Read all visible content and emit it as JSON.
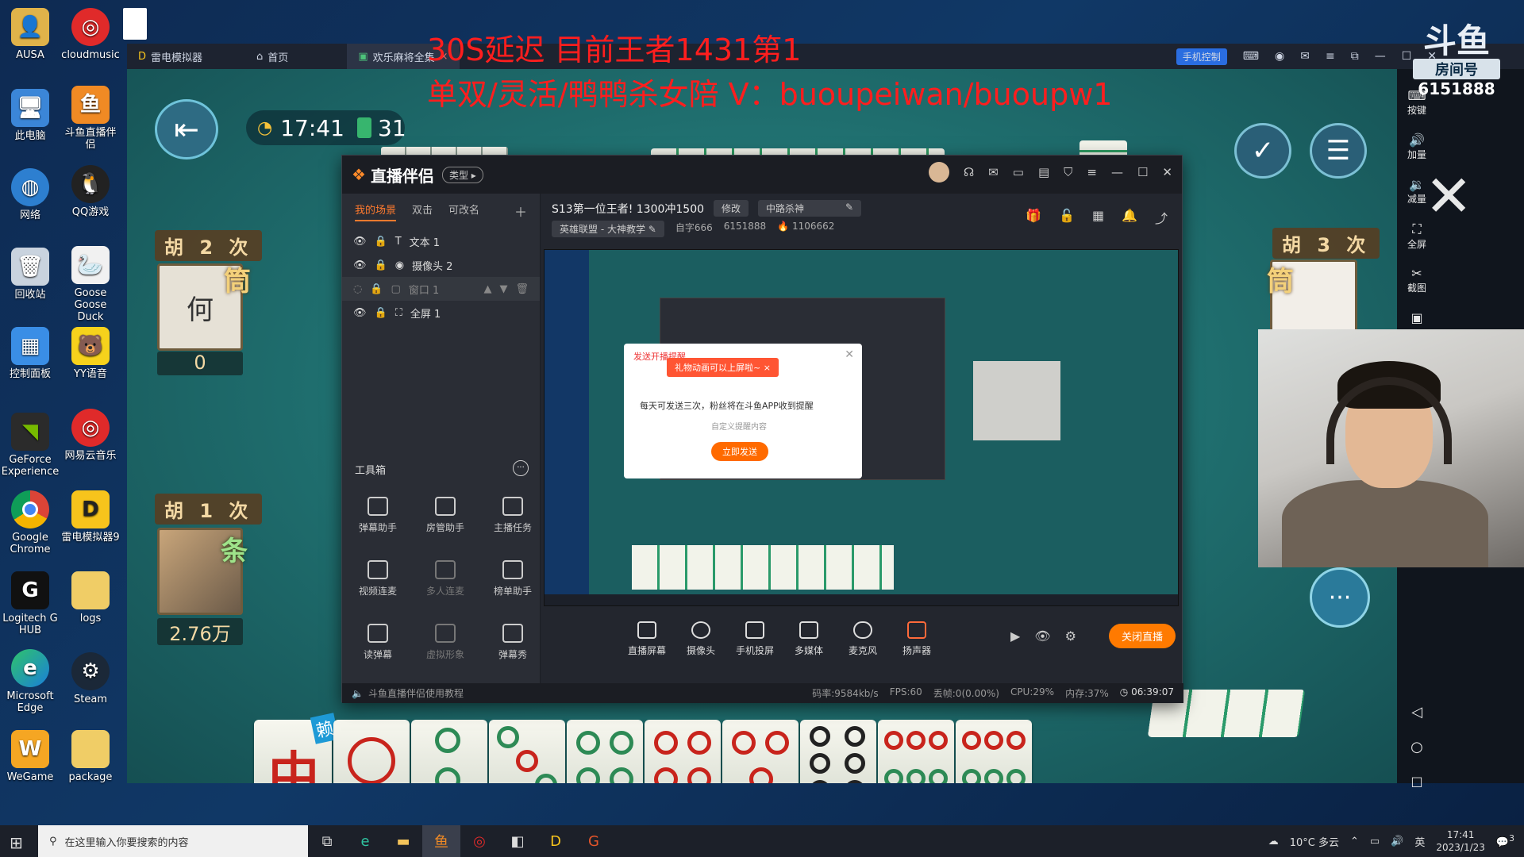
{
  "desktop": {
    "icons": [
      {
        "label": "AUSA"
      },
      {
        "label": "cloudmusic"
      },
      {
        "label": "此电脑"
      },
      {
        "label": "斗鱼直播伴侣"
      },
      {
        "label": "网络"
      },
      {
        "label": "QQ游戏"
      },
      {
        "label": "回收站"
      },
      {
        "label": "Goose Goose Duck"
      },
      {
        "label": "控制面板"
      },
      {
        "label": "YY语音"
      },
      {
        "label": "GeForce Experience"
      },
      {
        "label": "网易云音乐"
      },
      {
        "label": "Google Chrome"
      },
      {
        "label": "雷电模拟器9"
      },
      {
        "label": "Logitech G HUB"
      },
      {
        "label": "logs"
      },
      {
        "label": "Microsoft Edge"
      },
      {
        "label": "Steam"
      },
      {
        "label": "WeGame"
      },
      {
        "label": "package"
      }
    ]
  },
  "emulator": {
    "tabs": [
      "雷电模拟器",
      "首页",
      "欢乐麻将全集"
    ],
    "phone_control": "手机控制",
    "right_tools": [
      "按键",
      "加量",
      "减量",
      "全屏",
      "截图"
    ]
  },
  "overlay": {
    "line1": "30S延迟 目前王者1431第1",
    "line2": "单双/灵活/鸭鸭杀女陪 V：buoupeiwan/buoupw1"
  },
  "douyu": {
    "logo": "斗鱼",
    "room_label": "房间号",
    "room_number": "6151888"
  },
  "game": {
    "time": "17:41",
    "tiles_left": "31",
    "players": [
      {
        "hu": "胡 2 次",
        "suit": "筒",
        "name": "何",
        "score": "0"
      },
      {
        "hu": "胡 1 次",
        "suit": "条",
        "score": "2.76万"
      },
      {
        "hu": "胡 3 次",
        "suit": "筒"
      }
    ],
    "hand_badge": "赖"
  },
  "companion": {
    "title": "直播伴侣",
    "type_btn": "类型",
    "scene_tabs": [
      "我的场景",
      "双击",
      "可改名"
    ],
    "sources": [
      "文本 1",
      "摄像头 2",
      "窗口 1",
      "全屏 1"
    ],
    "toolbox_title": "工具箱",
    "tools": [
      "弹幕助手",
      "房管助手",
      "主播任务",
      "视频连麦",
      "多人连麦",
      "榜单助手",
      "读弹幕",
      "虚拟形象",
      "弹幕秀"
    ],
    "stream_title": "S13第一位王者! 1300冲1500",
    "edit_btn": "修改",
    "lane": "中路杀神",
    "category": "英雄联盟 - 大神教学",
    "streamer_id": "自字666",
    "room_id": "6151888",
    "heat": "1106662",
    "bottom_buttons": [
      "直播屏幕",
      "摄像头",
      "手机投屏",
      "多媒体",
      "麦克风",
      "扬声器"
    ],
    "stop_btn": "关闭直播",
    "tutorial": "斗鱼直播伴侣使用教程",
    "stats": [
      "码率:9584kb/s",
      "FPS:60",
      "丢帧:0(0.00%)",
      "CPU:29%",
      "内存:37%"
    ],
    "duration": "06:39:07",
    "popup": {
      "header": "发送开播提醒",
      "gift": "礼物动画可以上屏啦~",
      "text": "每天可发送三次，粉丝将在斗鱼APP收到提醒",
      "custom": "自定义提醒内容",
      "send": "立即发送"
    }
  },
  "taskbar": {
    "search_placeholder": "在这里输入你要搜索的内容",
    "weather": "10°C 多云",
    "ime": "英",
    "time": "17:41",
    "date": "2023/1/23",
    "notifications": "3"
  }
}
